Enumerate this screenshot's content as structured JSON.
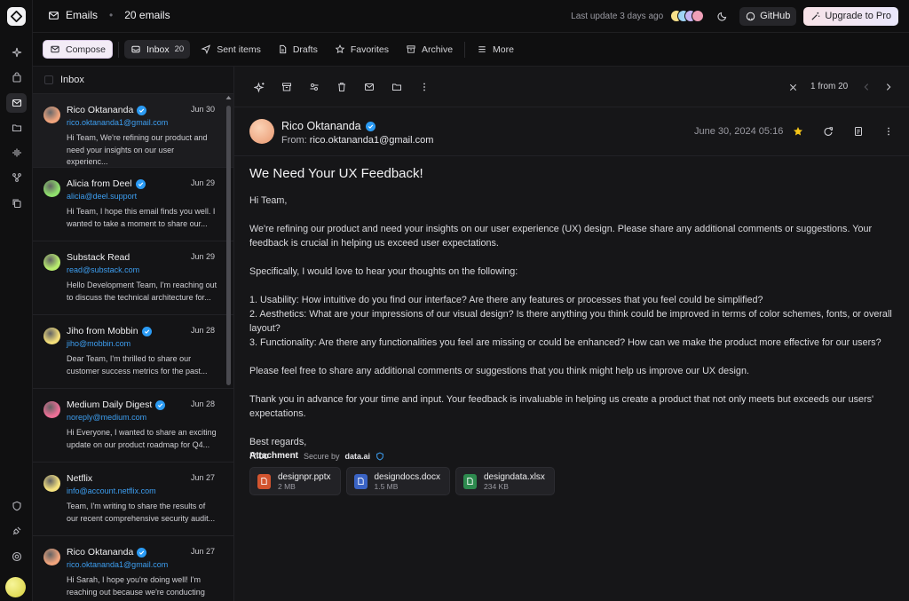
{
  "app": {
    "section": "Emails",
    "count_label": "20 emails"
  },
  "topbar": {
    "last_update": "Last update 3 days ago",
    "avatar_colors": [
      "#f7e08a",
      "#9fd4f5",
      "#c7b6f4",
      "#f0a0b8"
    ],
    "github_label": "GitHub",
    "upgrade_label": "Upgrade to Pro"
  },
  "nav": {
    "compose": "Compose",
    "inbox": "Inbox",
    "inbox_count": "20",
    "sent": "Sent items",
    "drafts": "Drafts",
    "favorites": "Favorites",
    "archive": "Archive",
    "more": "More"
  },
  "list": {
    "header": "Inbox",
    "items": [
      {
        "name": "Rico Oktananda",
        "verified": true,
        "date": "Jun 30",
        "email": "rico.oktananda1@gmail.com",
        "snippet": "Hi Team, We're refining our product and need your insights on our user experienc...",
        "avatar": "#f0a47d"
      },
      {
        "name": "Alicia from Deel",
        "verified": true,
        "date": "Jun 29",
        "email": "alicia@deel.support",
        "snippet": "Hi Team, I hope this email finds you well. I wanted to take a moment to share our...",
        "avatar": "#8fe06d"
      },
      {
        "name": "Substack Read",
        "verified": false,
        "date": "Jun 29",
        "email": "read@substack.com",
        "snippet": "Hello Development Team, I'm reaching out to discuss the technical architecture for...",
        "avatar": "#b8ec6e"
      },
      {
        "name": "Jiho from Mobbin",
        "verified": true,
        "date": "Jun 28",
        "email": "jiho@mobbin.com",
        "snippet": "Dear Team, I'm thrilled to share our customer success metrics for the past...",
        "avatar": "#f3de7a"
      },
      {
        "name": "Medium Daily Digest",
        "verified": true,
        "date": "Jun 28",
        "email": "noreply@medium.com",
        "snippet": "Hi Everyone, I wanted to share an exciting update on our product roadmap for Q4...",
        "avatar": "#ec6f96"
      },
      {
        "name": "Netflix",
        "verified": false,
        "date": "Jun 27",
        "email": "info@account.netflix.com",
        "snippet": "Team, I'm writing to share the results of our recent comprehensive security audit...",
        "avatar": "#f5e27f"
      },
      {
        "name": "Rico Oktananda",
        "verified": true,
        "date": "Jun 27",
        "email": "rico.oktananda1@gmail.com",
        "snippet": "Hi Sarah, I hope you're doing well! I'm reaching out because we're conducting a...",
        "avatar": "#f0a47d"
      }
    ]
  },
  "reader": {
    "pagination": "1 from 20",
    "sender_name": "Rico Oktananda",
    "from_label": "From:",
    "from_email": "rico.oktananda1@gmail.com",
    "date": "June 30, 2024 05:16",
    "subject": "We Need Your UX Feedback!",
    "greeting": "Hi Team,",
    "p1": "We're refining our product and need your insights on our user experience (UX) design. Please share any additional comments or suggestions. Your feedback is crucial in helping us exceed user expectations.",
    "p2": "Specifically, I would love to hear your thoughts on the following:",
    "l1": "1. Usability: How intuitive do you find our interface? Are there any features or processes that you feel could be simplified?",
    "l2": "2. Aesthetics: What are your impressions of our visual design? Is there anything you think could be improved in terms of color schemes, fonts, or overall layout?",
    "l3": "3. Functionality: Are there any functionalities you feel are missing or could be enhanced? How can we make the product more effective for our users?",
    "p3": "Please feel free to share any additional comments or suggestions that you think might help us improve our UX design.",
    "p4": "Thank you in advance for your time and input. Your feedback is invaluable in helping us create a product that not only meets but exceeds our users' expectations.",
    "signoff": "Best regards,",
    "signature": "Rico",
    "attachment_title": "Attachment",
    "secure_label": "Secure by",
    "secure_brand": "data.ai",
    "attachments": [
      {
        "name": "designpr.pptx",
        "size": "2 MB",
        "color": "#d2542f"
      },
      {
        "name": "designdocs.docx",
        "size": "1.5 MB",
        "color": "#3a63c4"
      },
      {
        "name": "designdata.xlsx",
        "size": "234 KB",
        "color": "#2d8a4e"
      }
    ]
  }
}
